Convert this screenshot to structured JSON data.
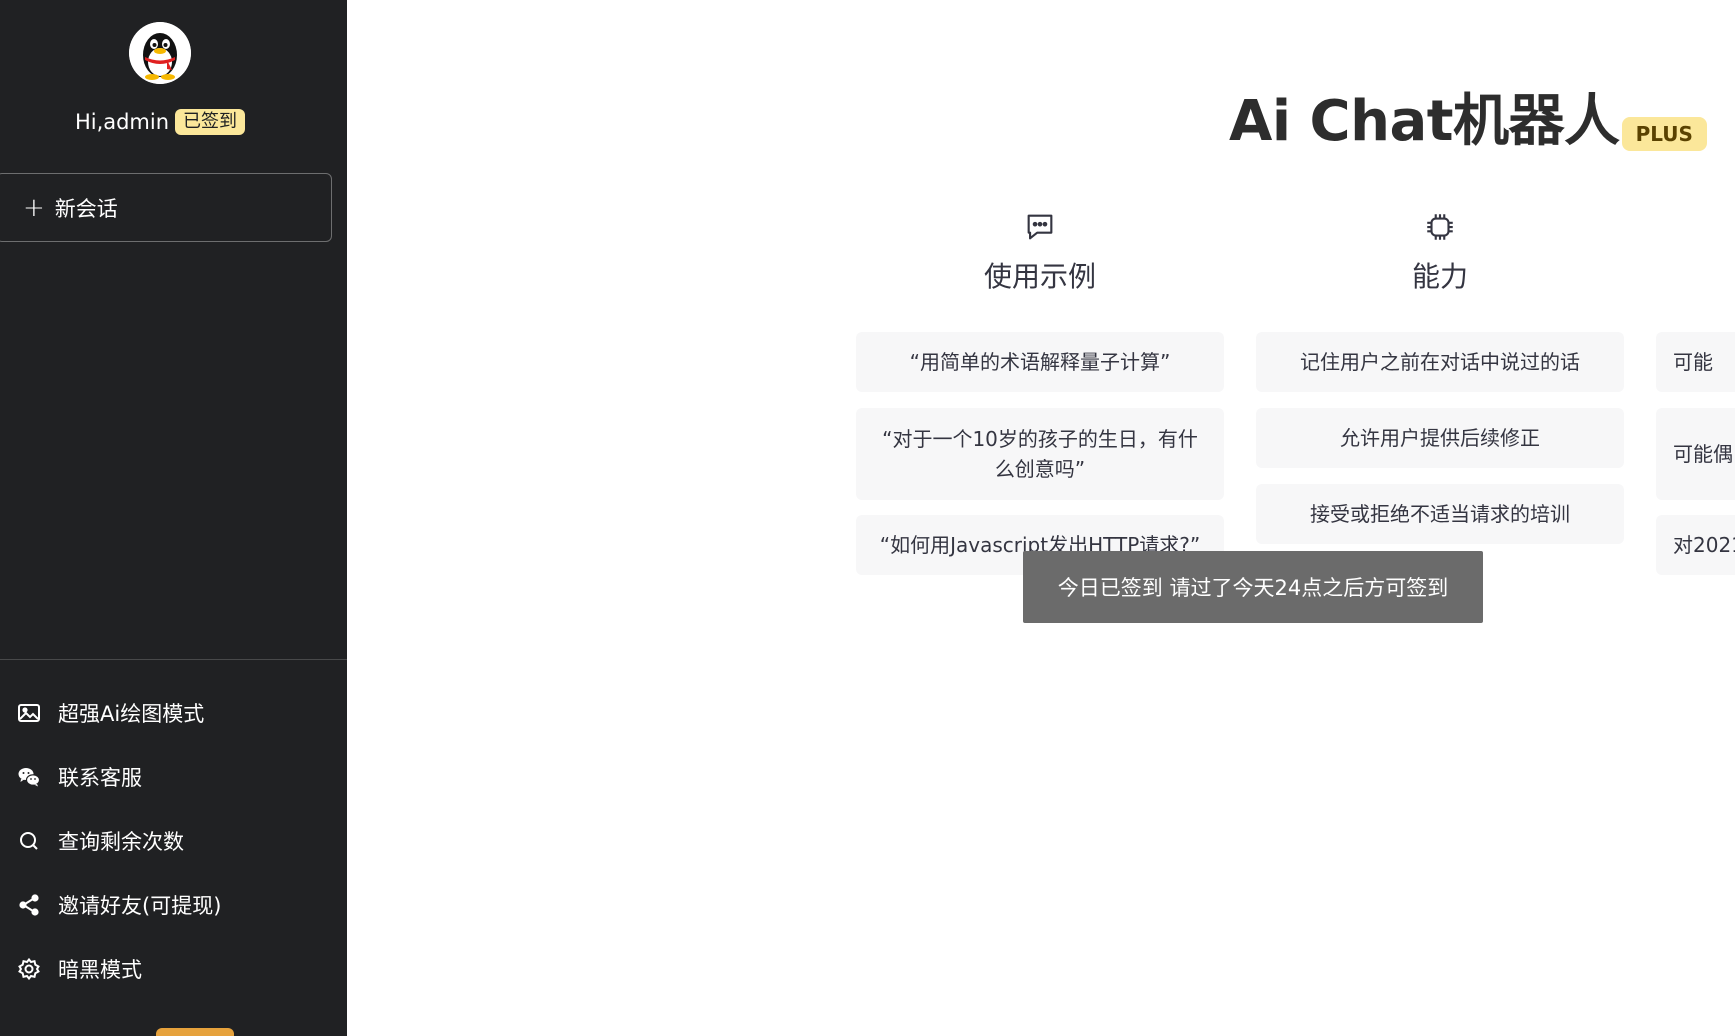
{
  "user": {
    "greeting": "Hi,admin",
    "signed_badge": "已签到"
  },
  "sidebar": {
    "new_chat_label": "新会话",
    "menu": [
      {
        "label": "超强Ai绘图模式",
        "icon": "image-icon"
      },
      {
        "label": "联系客服",
        "icon": "wechat-icon"
      },
      {
        "label": "查询剩余次数",
        "icon": "search-icon"
      },
      {
        "label": "邀请好友(可提现)",
        "icon": "share-icon"
      },
      {
        "label": "暗黑模式",
        "icon": "gear-icon"
      }
    ]
  },
  "main": {
    "title": "Ai Chat机器人",
    "plus_badge": "PLUS",
    "columns": [
      {
        "title": "使用示例",
        "icon": "chat-bubble-icon",
        "items": [
          "“用简单的术语解释量子计算”",
          "“对于一个10岁的孩子的生日，有什么创意吗”",
          "“如何用Javascript发出HTTP请求?”"
        ]
      },
      {
        "title": "能力",
        "icon": "cpu-chip-icon",
        "items": [
          "记住用户之前在对话中说过的话",
          "允许用户提供后续修正",
          "接受或拒绝不适当请求的培训"
        ]
      },
      {
        "title": "",
        "icon": "",
        "items": [
          "可能",
          "可能偶",
          "对2021"
        ]
      }
    ]
  },
  "toast": {
    "message": "今日已签到 请过了今天24点之后方可签到"
  },
  "colors": {
    "sidebar_bg": "#202123",
    "badge_yellow": "#fbe79a",
    "card_bg": "#f7f7f8",
    "toast_bg": "#6b6b6b"
  }
}
